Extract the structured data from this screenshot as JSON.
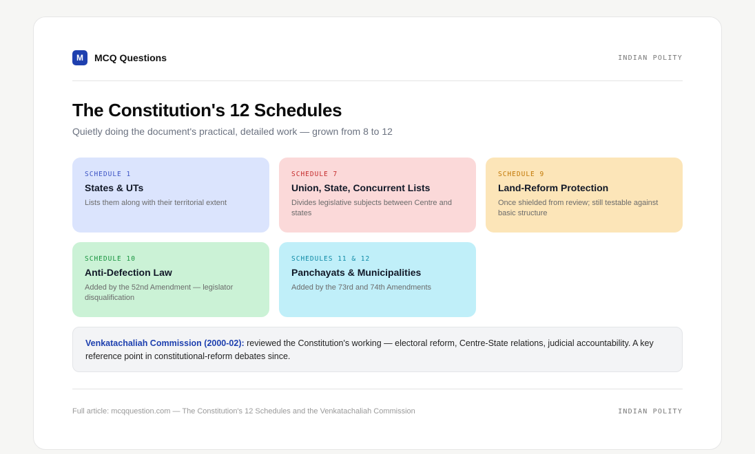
{
  "header": {
    "logo_letter": "M",
    "brand": "MCQ Questions",
    "tag": "INDIAN POLITY"
  },
  "title": "The Constitution's 12 Schedules",
  "subtitle": "Quietly doing the document's practical, detailed work — grown from 8 to 12",
  "schedules": [
    {
      "label": "SCHEDULE 1",
      "title": "States & UTs",
      "desc": "Lists them along with their territorial extent"
    },
    {
      "label": "SCHEDULE 7",
      "title": "Union, State, Concurrent Lists",
      "desc": "Divides legislative subjects between Centre and states"
    },
    {
      "label": "SCHEDULE 9",
      "title": "Land-Reform Protection",
      "desc": "Once shielded from review; still testable against basic structure"
    },
    {
      "label": "SCHEDULE 10",
      "title": "Anti-Defection Law",
      "desc": "Added by the 52nd Amendment — legislator disqualification"
    },
    {
      "label": "SCHEDULES 11 & 12",
      "title": "Panchayats & Municipalities",
      "desc": "Added by the 73rd and 74th Amendments"
    }
  ],
  "note": {
    "lead": "Venkatachaliah Commission (2000-02):",
    "text": " reviewed the Constitution's working — electoral reform, Centre-State relations, judicial accountability. A key reference point in constitutional-reform debates since."
  },
  "footer": {
    "text": "Full article: mcqquestion.com — The Constitution's 12 Schedules and the Venkatachaliah Commission",
    "tag": "INDIAN POLITY"
  },
  "colors": {
    "accent": "#1e40af",
    "schedule_1": "#dbe4fd",
    "schedule_7": "#fbd9d9",
    "schedule_9": "#fce5b8",
    "schedule_10": "#cbf2d6",
    "schedule_11_12": "#c0eff9"
  }
}
